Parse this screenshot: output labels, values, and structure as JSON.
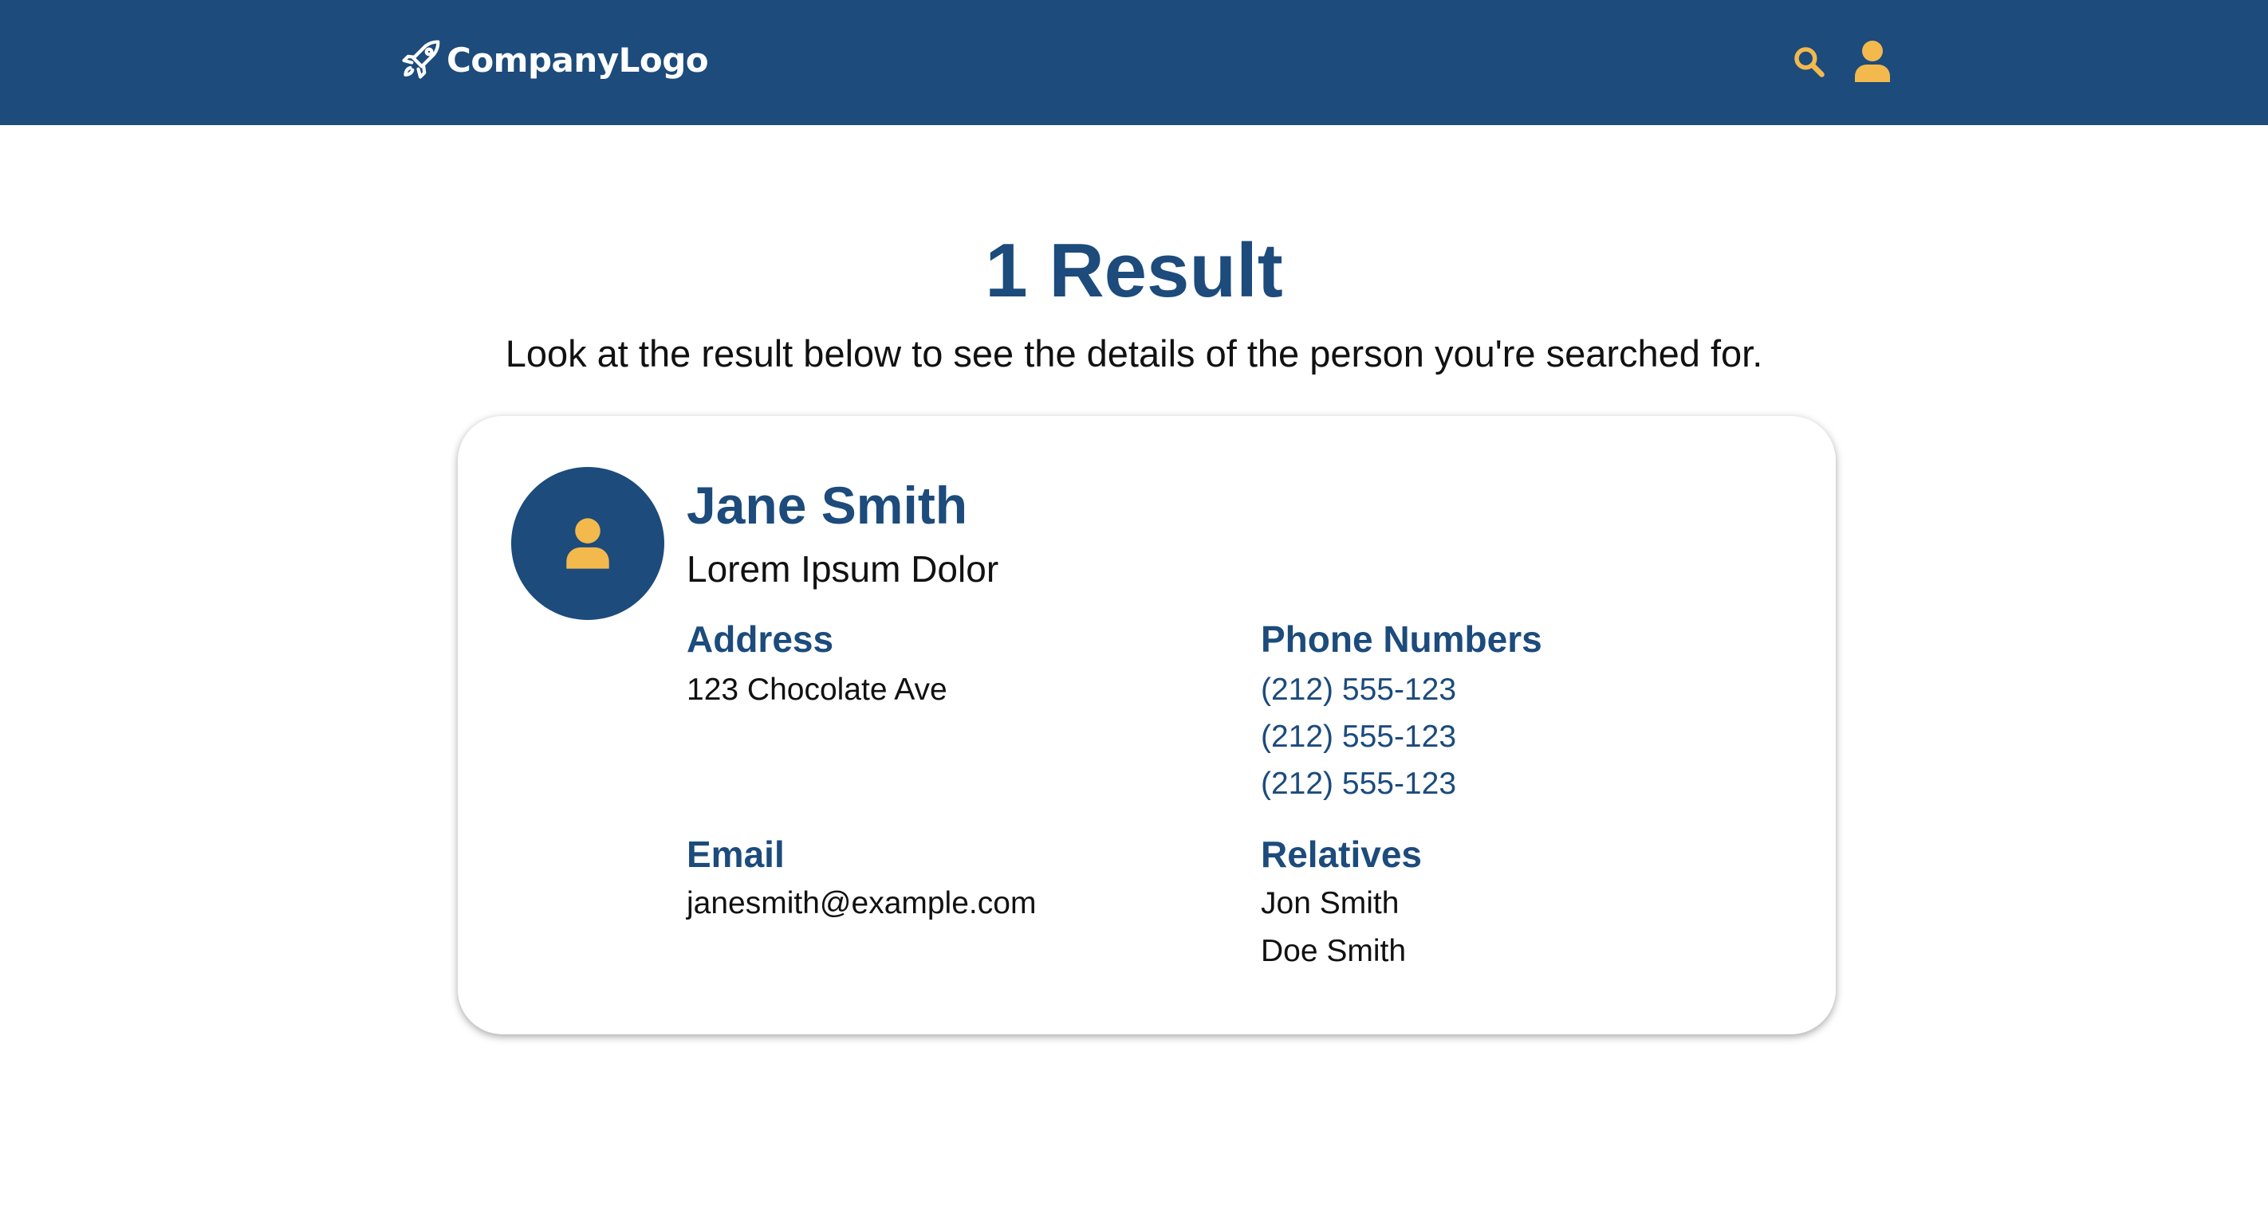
{
  "header": {
    "logo_text": "CompanyLogo",
    "logo_icon": "rocket-icon",
    "actions": {
      "search_icon": "search-icon",
      "user_icon": "user-icon"
    }
  },
  "main": {
    "title": "1 Result",
    "subtitle": "Look at the result below to see the details of the person you're searched for."
  },
  "result": {
    "avatar_icon": "user-icon",
    "name": "Jane Smith",
    "subtitle": "Lorem Ipsum Dolor",
    "address": {
      "label": "Address",
      "value": "123 Chocolate Ave"
    },
    "phone_numbers": {
      "label": "Phone Numbers",
      "values": [
        "(212) 555-123",
        "(212) 555-123",
        "(212) 555-123"
      ]
    },
    "email": {
      "label": "Email",
      "value": "janesmith@example.com"
    },
    "relatives": {
      "label": "Relatives",
      "values": [
        "Jon Smith",
        "Doe Smith"
      ]
    }
  },
  "colors": {
    "brand_blue": "#1c4b7c",
    "accent_yellow": "#f3b94d",
    "text": "#111111",
    "background": "#ffffff"
  }
}
